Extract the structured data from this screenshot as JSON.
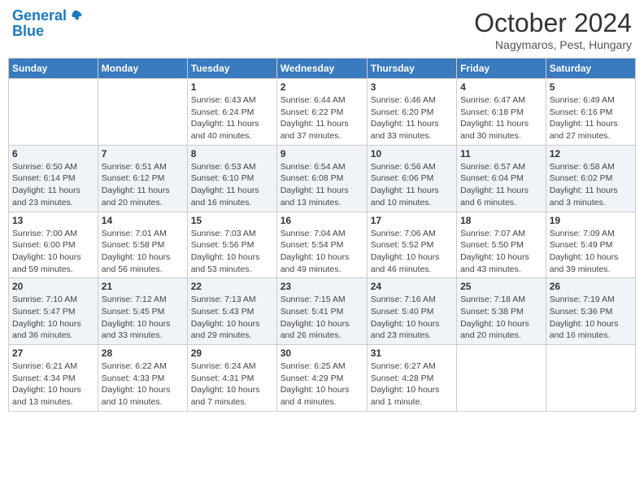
{
  "header": {
    "logo_line1": "General",
    "logo_line2": "Blue",
    "month": "October 2024",
    "location": "Nagymaros, Pest, Hungary"
  },
  "weekdays": [
    "Sunday",
    "Monday",
    "Tuesday",
    "Wednesday",
    "Thursday",
    "Friday",
    "Saturday"
  ],
  "weeks": [
    [
      {
        "day": "",
        "sunrise": "",
        "sunset": "",
        "daylight": ""
      },
      {
        "day": "",
        "sunrise": "",
        "sunset": "",
        "daylight": ""
      },
      {
        "day": "1",
        "sunrise": "Sunrise: 6:43 AM",
        "sunset": "Sunset: 6:24 PM",
        "daylight": "Daylight: 11 hours and 40 minutes."
      },
      {
        "day": "2",
        "sunrise": "Sunrise: 6:44 AM",
        "sunset": "Sunset: 6:22 PM",
        "daylight": "Daylight: 11 hours and 37 minutes."
      },
      {
        "day": "3",
        "sunrise": "Sunrise: 6:46 AM",
        "sunset": "Sunset: 6:20 PM",
        "daylight": "Daylight: 11 hours and 33 minutes."
      },
      {
        "day": "4",
        "sunrise": "Sunrise: 6:47 AM",
        "sunset": "Sunset: 6:18 PM",
        "daylight": "Daylight: 11 hours and 30 minutes."
      },
      {
        "day": "5",
        "sunrise": "Sunrise: 6:49 AM",
        "sunset": "Sunset: 6:16 PM",
        "daylight": "Daylight: 11 hours and 27 minutes."
      }
    ],
    [
      {
        "day": "6",
        "sunrise": "Sunrise: 6:50 AM",
        "sunset": "Sunset: 6:14 PM",
        "daylight": "Daylight: 11 hours and 23 minutes."
      },
      {
        "day": "7",
        "sunrise": "Sunrise: 6:51 AM",
        "sunset": "Sunset: 6:12 PM",
        "daylight": "Daylight: 11 hours and 20 minutes."
      },
      {
        "day": "8",
        "sunrise": "Sunrise: 6:53 AM",
        "sunset": "Sunset: 6:10 PM",
        "daylight": "Daylight: 11 hours and 16 minutes."
      },
      {
        "day": "9",
        "sunrise": "Sunrise: 6:54 AM",
        "sunset": "Sunset: 6:08 PM",
        "daylight": "Daylight: 11 hours and 13 minutes."
      },
      {
        "day": "10",
        "sunrise": "Sunrise: 6:56 AM",
        "sunset": "Sunset: 6:06 PM",
        "daylight": "Daylight: 11 hours and 10 minutes."
      },
      {
        "day": "11",
        "sunrise": "Sunrise: 6:57 AM",
        "sunset": "Sunset: 6:04 PM",
        "daylight": "Daylight: 11 hours and 6 minutes."
      },
      {
        "day": "12",
        "sunrise": "Sunrise: 6:58 AM",
        "sunset": "Sunset: 6:02 PM",
        "daylight": "Daylight: 11 hours and 3 minutes."
      }
    ],
    [
      {
        "day": "13",
        "sunrise": "Sunrise: 7:00 AM",
        "sunset": "Sunset: 6:00 PM",
        "daylight": "Daylight: 10 hours and 59 minutes."
      },
      {
        "day": "14",
        "sunrise": "Sunrise: 7:01 AM",
        "sunset": "Sunset: 5:58 PM",
        "daylight": "Daylight: 10 hours and 56 minutes."
      },
      {
        "day": "15",
        "sunrise": "Sunrise: 7:03 AM",
        "sunset": "Sunset: 5:56 PM",
        "daylight": "Daylight: 10 hours and 53 minutes."
      },
      {
        "day": "16",
        "sunrise": "Sunrise: 7:04 AM",
        "sunset": "Sunset: 5:54 PM",
        "daylight": "Daylight: 10 hours and 49 minutes."
      },
      {
        "day": "17",
        "sunrise": "Sunrise: 7:06 AM",
        "sunset": "Sunset: 5:52 PM",
        "daylight": "Daylight: 10 hours and 46 minutes."
      },
      {
        "day": "18",
        "sunrise": "Sunrise: 7:07 AM",
        "sunset": "Sunset: 5:50 PM",
        "daylight": "Daylight: 10 hours and 43 minutes."
      },
      {
        "day": "19",
        "sunrise": "Sunrise: 7:09 AM",
        "sunset": "Sunset: 5:49 PM",
        "daylight": "Daylight: 10 hours and 39 minutes."
      }
    ],
    [
      {
        "day": "20",
        "sunrise": "Sunrise: 7:10 AM",
        "sunset": "Sunset: 5:47 PM",
        "daylight": "Daylight: 10 hours and 36 minutes."
      },
      {
        "day": "21",
        "sunrise": "Sunrise: 7:12 AM",
        "sunset": "Sunset: 5:45 PM",
        "daylight": "Daylight: 10 hours and 33 minutes."
      },
      {
        "day": "22",
        "sunrise": "Sunrise: 7:13 AM",
        "sunset": "Sunset: 5:43 PM",
        "daylight": "Daylight: 10 hours and 29 minutes."
      },
      {
        "day": "23",
        "sunrise": "Sunrise: 7:15 AM",
        "sunset": "Sunset: 5:41 PM",
        "daylight": "Daylight: 10 hours and 26 minutes."
      },
      {
        "day": "24",
        "sunrise": "Sunrise: 7:16 AM",
        "sunset": "Sunset: 5:40 PM",
        "daylight": "Daylight: 10 hours and 23 minutes."
      },
      {
        "day": "25",
        "sunrise": "Sunrise: 7:18 AM",
        "sunset": "Sunset: 5:38 PM",
        "daylight": "Daylight: 10 hours and 20 minutes."
      },
      {
        "day": "26",
        "sunrise": "Sunrise: 7:19 AM",
        "sunset": "Sunset: 5:36 PM",
        "daylight": "Daylight: 10 hours and 16 minutes."
      }
    ],
    [
      {
        "day": "27",
        "sunrise": "Sunrise: 6:21 AM",
        "sunset": "Sunset: 4:34 PM",
        "daylight": "Daylight: 10 hours and 13 minutes."
      },
      {
        "day": "28",
        "sunrise": "Sunrise: 6:22 AM",
        "sunset": "Sunset: 4:33 PM",
        "daylight": "Daylight: 10 hours and 10 minutes."
      },
      {
        "day": "29",
        "sunrise": "Sunrise: 6:24 AM",
        "sunset": "Sunset: 4:31 PM",
        "daylight": "Daylight: 10 hours and 7 minutes."
      },
      {
        "day": "30",
        "sunrise": "Sunrise: 6:25 AM",
        "sunset": "Sunset: 4:29 PM",
        "daylight": "Daylight: 10 hours and 4 minutes."
      },
      {
        "day": "31",
        "sunrise": "Sunrise: 6:27 AM",
        "sunset": "Sunset: 4:28 PM",
        "daylight": "Daylight: 10 hours and 1 minute."
      },
      {
        "day": "",
        "sunrise": "",
        "sunset": "",
        "daylight": ""
      },
      {
        "day": "",
        "sunrise": "",
        "sunset": "",
        "daylight": ""
      }
    ]
  ]
}
